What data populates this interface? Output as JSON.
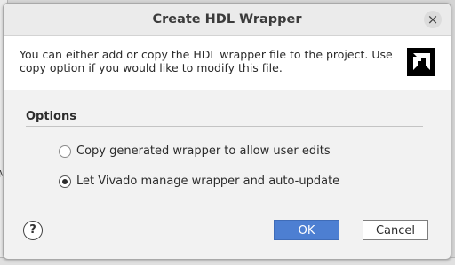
{
  "dialog": {
    "title": "Create HDL Wrapper",
    "close_glyph": "×",
    "info_text": "You can either add or copy the HDL wrapper file to the project. Use copy option if you would like to modify this file.",
    "logo_icon": "amd-logo"
  },
  "options": {
    "heading": "Options",
    "items": [
      {
        "label": "Copy generated wrapper to allow user edits",
        "selected": false
      },
      {
        "label": "Let Vivado manage wrapper and auto-update",
        "selected": true
      }
    ]
  },
  "footer": {
    "help_glyph": "?",
    "ok_label": "OK",
    "cancel_label": "Cancel"
  },
  "background": {
    "left_mark": "M"
  },
  "colors": {
    "primary_button": "#4d7fd2",
    "dialog_bg": "#f2f2f2",
    "panel_bg": "#ffffff"
  }
}
